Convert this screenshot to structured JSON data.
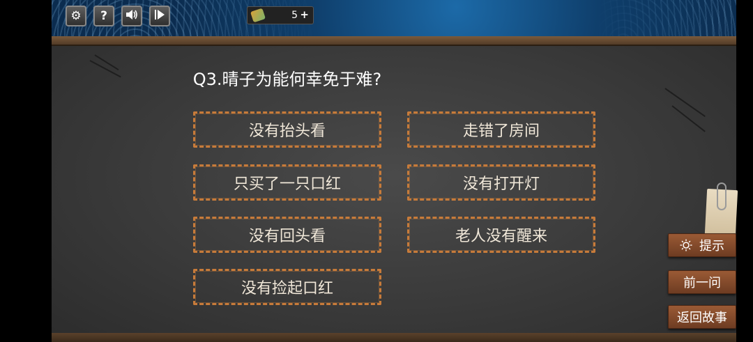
{
  "toolbar": {
    "buttons": [
      {
        "name": "settings-button",
        "icon": "gear-icon",
        "glyph": "⚙"
      },
      {
        "name": "help-button",
        "icon": "question-icon",
        "glyph": "?"
      },
      {
        "name": "sound-button",
        "icon": "speaker-icon",
        "glyph": "🔊"
      },
      {
        "name": "play-button",
        "icon": "play-icon",
        "glyph": "▶"
      }
    ],
    "coins": {
      "count": "5",
      "plus": "+",
      "icon": "ticket-icon"
    }
  },
  "question": {
    "text": "Q3.晴子为能何幸免于难?"
  },
  "answers": [
    {
      "label": "没有抬头看"
    },
    {
      "label": "走错了房间"
    },
    {
      "label": "只买了一只口红"
    },
    {
      "label": "没有打开灯"
    },
    {
      "label": "没有回头看"
    },
    {
      "label": "老人没有醒来"
    },
    {
      "label": "没有捡起口红"
    }
  ],
  "side": {
    "hint_label": "提示",
    "prev_label": "前一问",
    "back_label": "返回故事"
  },
  "colors": {
    "answer_border": "#c77b3a",
    "side_button": "#8a4d2d",
    "board": "#3a3a3a"
  }
}
